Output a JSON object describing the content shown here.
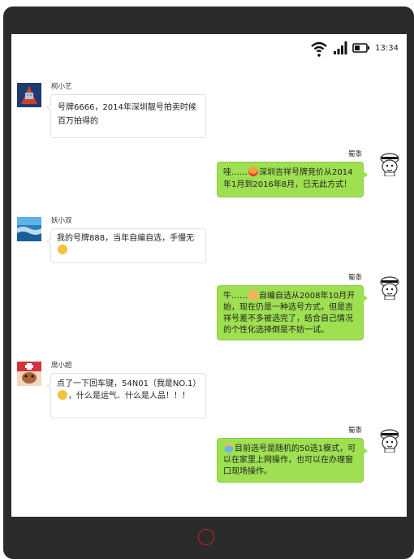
{
  "status_bar": {
    "time": "13:34",
    "wifi_icon": "wifi-icon",
    "signal_icon": "signal-icon",
    "battery_icon": "battery-icon"
  },
  "messages": [
    {
      "side": "left",
      "name": "柯小艺",
      "text": "号牌6666，2014年深圳靓号拍卖时候百万拍得的",
      "emoji": ""
    },
    {
      "side": "right",
      "name": "蜀黍",
      "text_before": "哇……",
      "emoji": "tongue-face-emoji",
      "text_after": "深圳吉祥号牌竞价从2014年1月到2016年8月，已无此方式！"
    },
    {
      "side": "left",
      "name": "妖小双",
      "text": "我的号牌888，当年自编自选，手慢无",
      "emoji": "smile-emoji"
    },
    {
      "side": "right",
      "name": "蜀黍",
      "text_before": "牛……",
      "emoji": "thumbs-up-emoji",
      "text_after": "自编自选从2008年10月开始，现在仍是一种选号方式，但是吉祥号差不多被选完了，结合自己情况的个性化选择倒是不妨一试。"
    },
    {
      "side": "left",
      "name": "席小超",
      "text_before": "点了一下回车键，54N01（我是NO.1）",
      "emoji": "sweat-smile-emoji",
      "text_after": "，什么是运气、什么是人品！！！"
    },
    {
      "side": "right",
      "name": "蜀黍",
      "text_before": "",
      "emoji": "scream-emoji",
      "text_after": "目前选号是随机的50选1模式，可以在家里上网操作，也可以在办理窗口现场操作。"
    }
  ],
  "colors": {
    "bubble_self": "#9ee051",
    "bubble_other": "#ffffff",
    "phone_frame": "#2b2b2b",
    "home_ring": "#c8202a"
  }
}
